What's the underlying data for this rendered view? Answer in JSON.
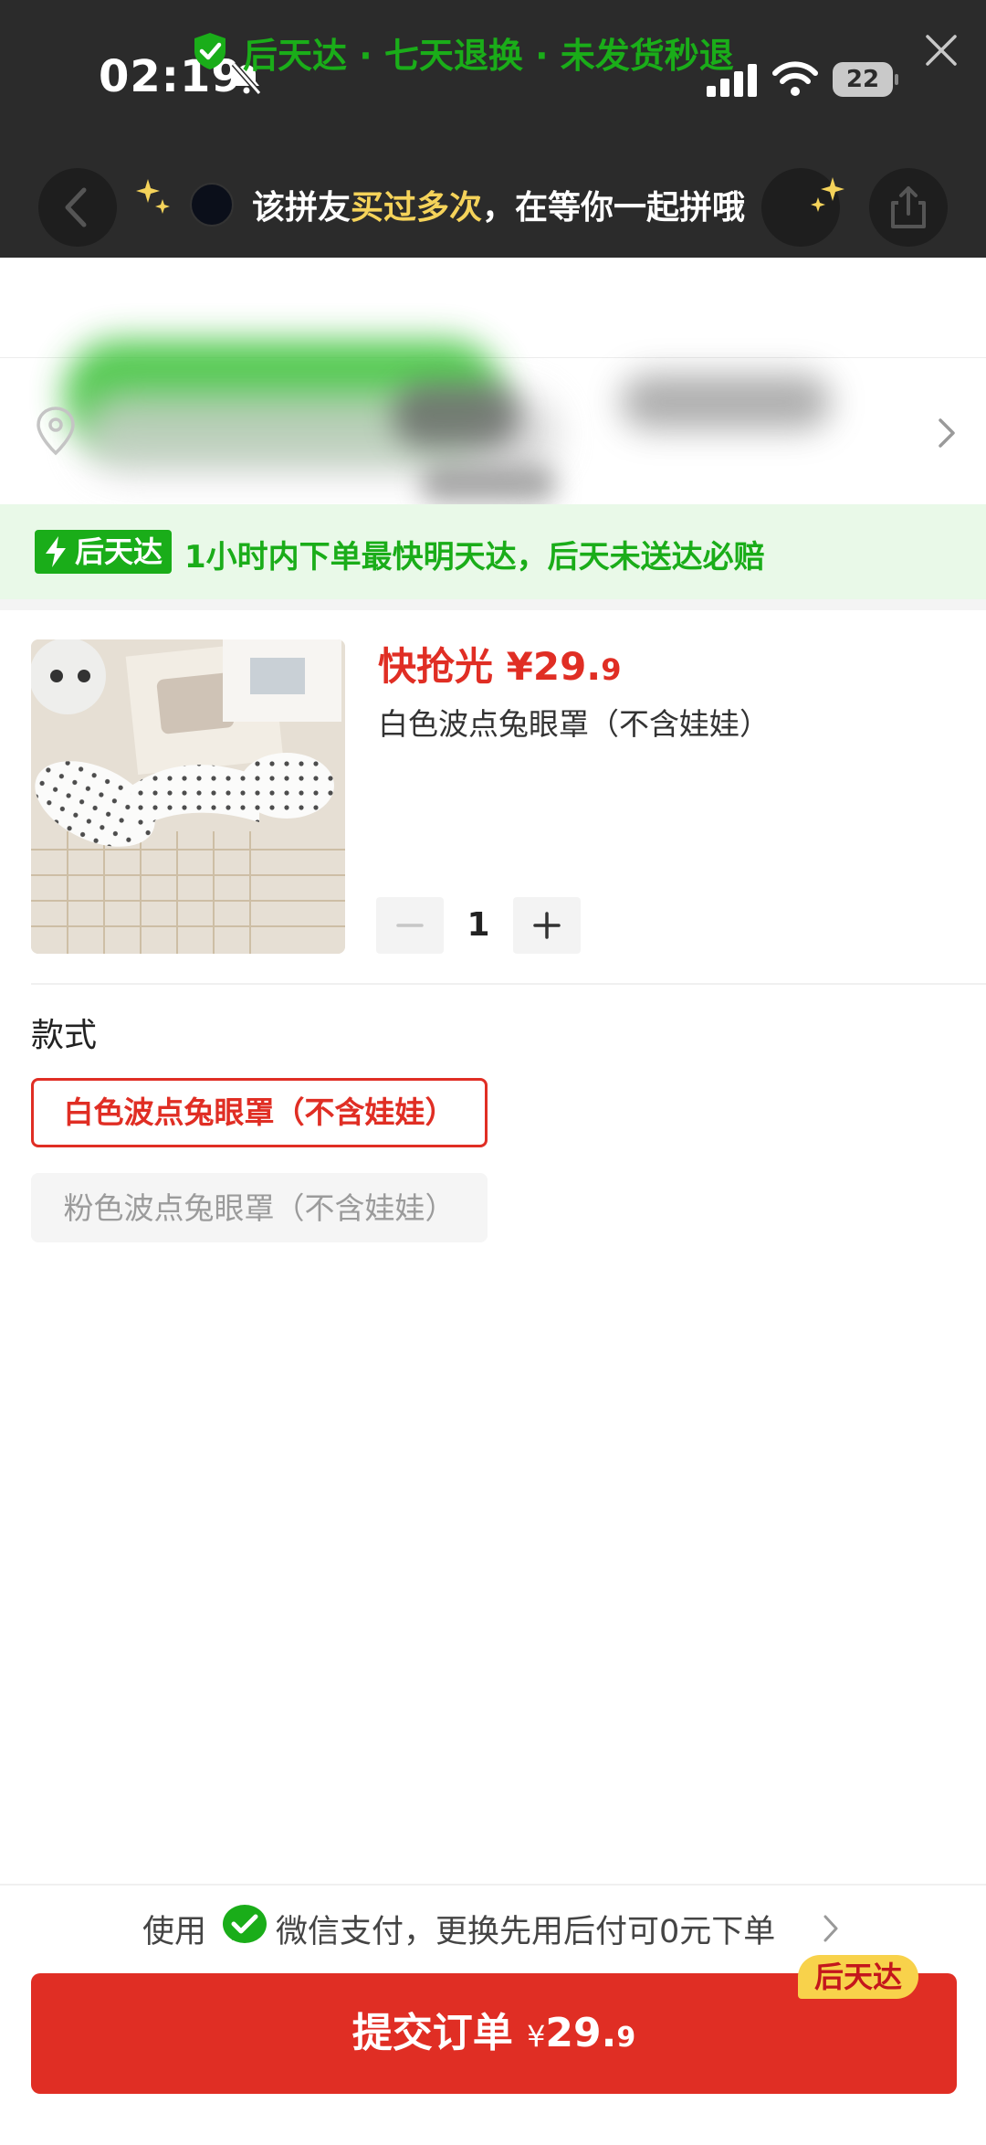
{
  "status_bar": {
    "time": "02:19",
    "battery": "22"
  },
  "nav": {
    "message_prefix": "该拼友",
    "message_highlight": "买过多次",
    "message_suffix": "，在等你一起拼哦"
  },
  "guarantee": {
    "text": "后天达 · 七天退换 · 未发货秒退"
  },
  "delivery": {
    "badge": "后天达",
    "text": "1小时内下单最快明天达，后天未送达必赔"
  },
  "product": {
    "price_label": "快抢光 ¥29.",
    "price_cents": "9",
    "name": "白色波点兔眼罩（不含娃娃）",
    "quantity": "1"
  },
  "style": {
    "label": "款式",
    "options": [
      {
        "label": "白色波点兔眼罩（不含娃娃）",
        "selected": true
      },
      {
        "label": "粉色波点兔眼罩（不含娃娃）",
        "selected": false
      }
    ]
  },
  "payment": {
    "prefix": "使用",
    "text": "微信支付，更换先用后付可0元下单"
  },
  "submit": {
    "label": "提交订单",
    "currency": "¥",
    "amount": "29.",
    "cents": "9",
    "badge": "后天达"
  },
  "colors": {
    "accent_red": "#e02e24",
    "accent_green": "#1aad19",
    "badge_yellow": "#f8d24b"
  }
}
